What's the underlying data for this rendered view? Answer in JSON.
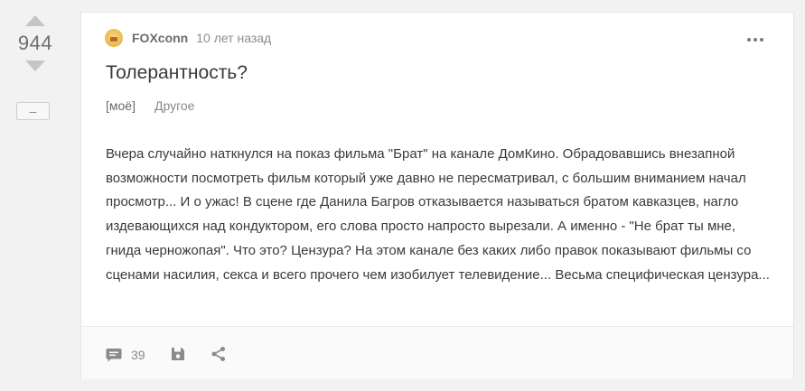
{
  "rating": {
    "count": "944",
    "collapse_label": "–"
  },
  "post": {
    "author": "FOXconn",
    "time": "10 лет назад",
    "title": "Толерантность?",
    "tags": [
      "[моё]",
      "Другое"
    ],
    "content": "Вчера случайно наткнулся на показ фильма \"Брат\" на канале ДомКино. Обрадовавшись внезапной возможности посмотреть фильм который уже давно не пересматривал, с большим вниманием начал просмотр... И о ужас! В сцене где Данила Багров отказывается называться братом кавказцев, нагло издевающихся над кондуктором, его слова просто напросто вырезали. А именно - \"Не брат ты мне, гнида черножопая\". Что это? Цензура? На этом канале без каких либо правок показывают фильмы со сценами насилия, секса и всего прочего чем изобилует телевидение... Весьма специфическая цензура..."
  },
  "footer": {
    "comments_count": "39"
  },
  "icons": {
    "upvote": "arrow-up-icon",
    "downvote": "arrow-down-icon",
    "more": "more-dots-icon",
    "comments": "comment-icon",
    "save": "save-icon",
    "share": "share-icon"
  },
  "colors": {
    "background": "#f2f2f2",
    "card": "#ffffff",
    "text": "#3a3a3a",
    "muted": "#8a8a8a",
    "arrow": "#c5c5c5"
  }
}
